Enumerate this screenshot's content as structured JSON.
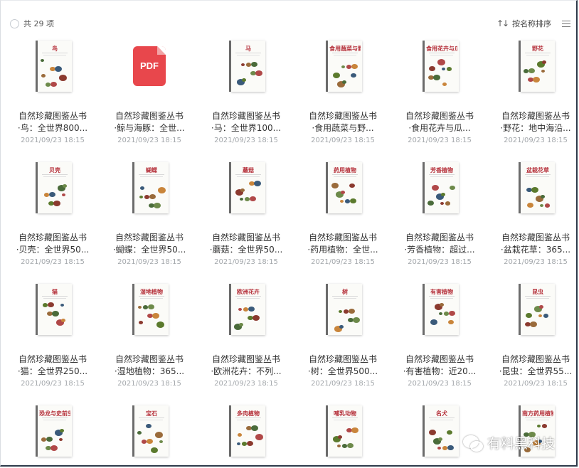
{
  "header": {
    "item_count": "共 29 项",
    "sort_label": "按名称排序",
    "sort_icon": "sort-arrows-icon",
    "view_icon": "list-view-icon"
  },
  "items": [
    {
      "line1": "自然珍藏图鉴丛书",
      "line2": "·鸟：全世界800...",
      "date": "2021/09/23 18:15",
      "cover": "鸟",
      "color": "#b5303a"
    },
    {
      "line1": "自然珍藏图鉴丛书",
      "line2": "·鲸与海豚：全世...",
      "date": "2021/09/23 18:15",
      "pdf": "PDF"
    },
    {
      "line1": "自然珍藏图鉴丛书",
      "line2": "·马：全世界100...",
      "date": "2021/09/23 18:15",
      "cover": "马",
      "color": "#b5303a"
    },
    {
      "line1": "自然珍藏图鉴丛书",
      "line2": "·食用蔬菜与野...",
      "date": "2021/09/23 18:15",
      "cover": "食用蔬菜与野菜",
      "color": "#b5303a"
    },
    {
      "line1": "自然珍藏图鉴丛书",
      "line2": "·食用花卉与瓜...",
      "date": "2021/09/23 18:15",
      "cover": "食用花卉与瓜果",
      "color": "#b5303a"
    },
    {
      "line1": "自然珍藏图鉴丛书",
      "line2": "·野花：地中海沿...",
      "date": "2021/09/23 18:15",
      "cover": "野花",
      "color": "#b5303a"
    },
    {
      "line1": "自然珍藏图鉴丛书",
      "line2": "·贝壳：全世界50...",
      "date": "2021/09/23 18:15",
      "cover": "贝壳",
      "color": "#b5303a"
    },
    {
      "line1": "自然珍藏图鉴丛书",
      "line2": "·蝴蝶：全世界50...",
      "date": "2021/09/23 18:15",
      "cover": "蝴蝶",
      "color": "#b5303a"
    },
    {
      "line1": "自然珍藏图鉴丛书",
      "line2": "·蘑菇：全世界50...",
      "date": "2021/09/23 18:15",
      "cover": "蘑菇",
      "color": "#b5303a"
    },
    {
      "line1": "自然珍藏图鉴丛书",
      "line2": "·药用植物：全世...",
      "date": "2021/09/23 18:15",
      "cover": "药用植物",
      "color": "#b5303a"
    },
    {
      "line1": "自然珍藏图鉴丛书",
      "line2": "·芳香植物：超过...",
      "date": "2021/09/23 18:15",
      "cover": "芳香植物",
      "color": "#b5303a"
    },
    {
      "line1": "自然珍藏图鉴丛书",
      "line2": "·盆栽花草：365...",
      "date": "2021/09/23 18:15",
      "cover": "盆栽花草",
      "color": "#b5303a"
    },
    {
      "line1": "自然珍藏图鉴丛书",
      "line2": "·猫：全世界250...",
      "date": "2021/09/23 18:15",
      "cover": "猫",
      "color": "#b5303a"
    },
    {
      "line1": "自然珍藏图鉴丛书",
      "line2": "·湿地植物：365...",
      "date": "2021/09/23 18:15",
      "cover": "湿地植物",
      "color": "#b5303a"
    },
    {
      "line1": "自然珍藏图鉴丛书",
      "line2": "·欧洲花卉：不列...",
      "date": "2021/09/23 18:15",
      "cover": "欧洲花卉",
      "color": "#b5303a"
    },
    {
      "line1": "自然珍藏图鉴丛书",
      "line2": "·树：全世界500...",
      "date": "2021/09/23 18:15",
      "cover": "树",
      "color": "#b5303a"
    },
    {
      "line1": "自然珍藏图鉴丛书",
      "line2": "·有害植物：近20...",
      "date": "2021/09/23 18:15",
      "cover": "有害植物",
      "color": "#b5303a"
    },
    {
      "line1": "自然珍藏图鉴丛书",
      "line2": "·昆虫：全世界55...",
      "date": "2021/09/23 18:15",
      "cover": "昆虫",
      "color": "#b5303a"
    },
    {
      "cover": "恐龙与史前生命",
      "color": "#b5303a"
    },
    {
      "cover": "宝石",
      "color": "#b5303a"
    },
    {
      "cover": "多肉植物",
      "color": "#b5303a"
    },
    {
      "cover": "哺乳动物",
      "color": "#b5303a"
    },
    {
      "cover": "名犬",
      "color": "#b5303a"
    },
    {
      "cover": "南方药用植物",
      "color": "#b5303a"
    }
  ],
  "watermark": {
    "text": "有料黑科技",
    "icon": "wechat-icon"
  }
}
